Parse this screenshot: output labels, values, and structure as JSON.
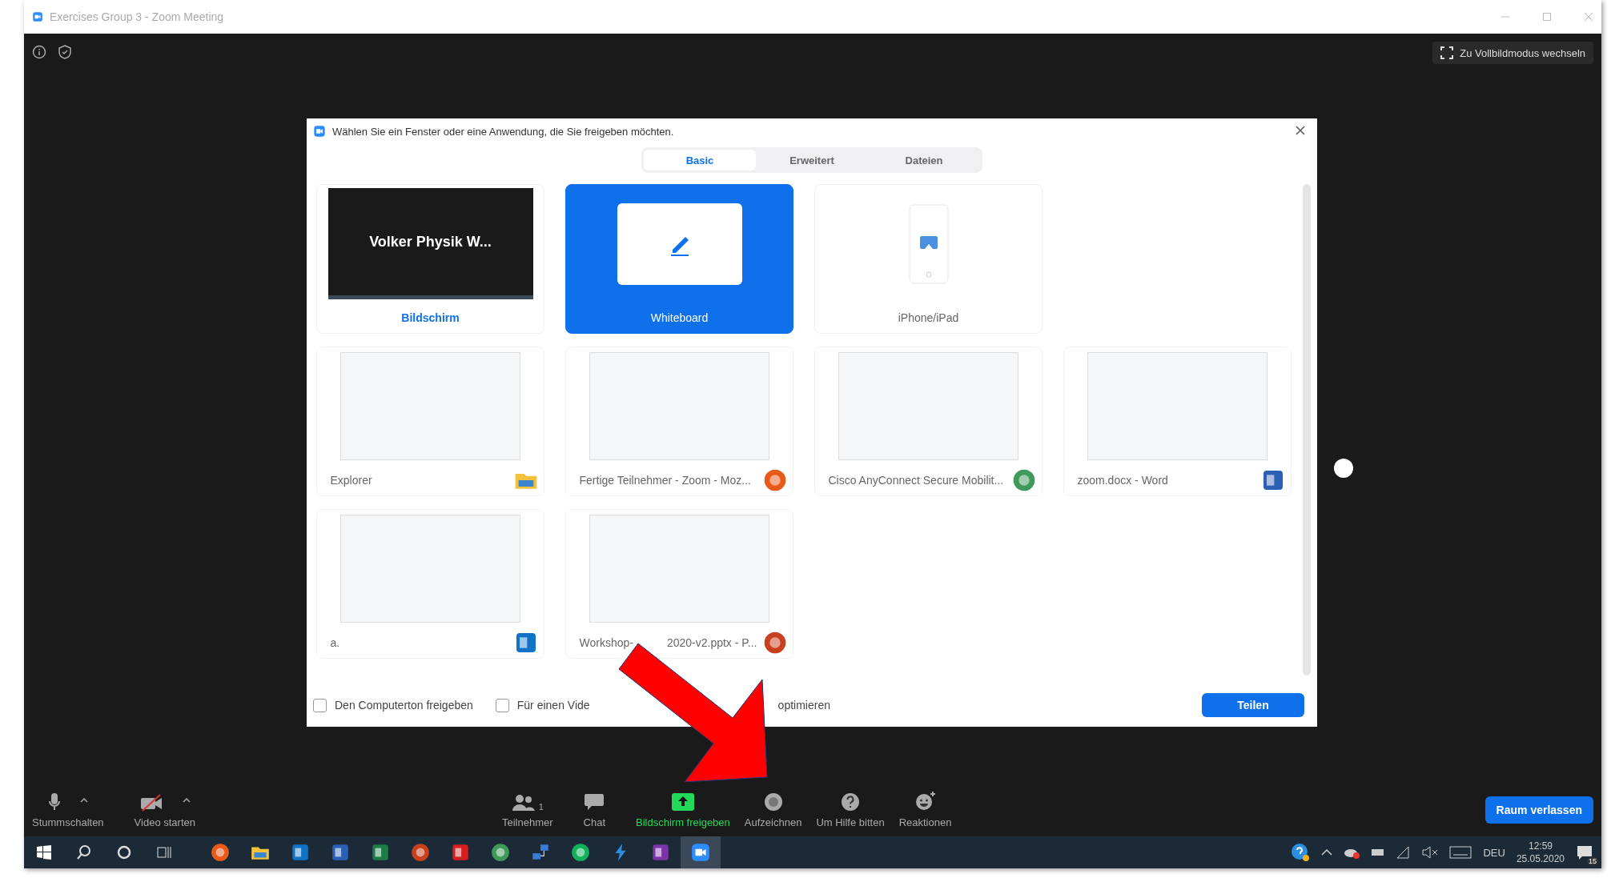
{
  "window": {
    "title": "Exercises Group 3 - Zoom Meeting"
  },
  "fullscreen_button": "Zu Vollbildmodus wechseln",
  "dialog": {
    "title": "Wählen Sie ein Fenster oder eine Anwendung, die Sie freigeben möchten.",
    "tabs": [
      {
        "label": "Basic",
        "selected": true
      },
      {
        "label": "Erweitert",
        "selected": false
      },
      {
        "label": "Dateien",
        "selected": false
      }
    ],
    "sources": [
      {
        "kind": "screen",
        "label": "Bildschirm",
        "selected": false,
        "emphasized": true,
        "preview_text": "Volker Physik W..."
      },
      {
        "kind": "whiteboard",
        "label": "Whiteboard",
        "selected": true,
        "emphasized": false
      },
      {
        "kind": "device",
        "label": "iPhone/iPad",
        "selected": false,
        "emphasized": false
      },
      {
        "kind": "folder",
        "label": "Explorer",
        "selected": false,
        "emphasized": false
      },
      {
        "kind": "browser",
        "label": "Fertige Teilnehmer - Zoom - Moz...",
        "selected": false,
        "emphasized": false
      },
      {
        "kind": "globe",
        "label": "Cisco AnyConnect Secure Mobilit...",
        "selected": false,
        "emphasized": false
      },
      {
        "kind": "document",
        "label": "zoom.docx - Word",
        "selected": false,
        "emphasized": false
      },
      {
        "kind": "mail",
        "label": "a.",
        "selected": false,
        "emphasized": false
      },
      {
        "kind": "presentation",
        "label": "Workshop-",
        "label_end": "2020-v2.pptx - P...",
        "selected": false,
        "emphasized": false
      }
    ],
    "options": [
      {
        "label": "Den Computerton freigeben",
        "checked": false
      },
      {
        "label": "Für einen Vide",
        "label_end": "optimieren",
        "checked": false
      }
    ],
    "share_button": "Teilen"
  },
  "toolbar": [
    {
      "kind": "mic",
      "label": "Stummschalten",
      "caret": true,
      "highlighted": false
    },
    {
      "kind": "video-off",
      "label": "Video starten",
      "caret": true,
      "highlighted": false
    },
    {
      "kind": "participants",
      "label": "Teilnehmer",
      "count": "1",
      "caret": false,
      "highlighted": false
    },
    {
      "kind": "chat",
      "label": "Chat",
      "caret": false,
      "highlighted": false
    },
    {
      "kind": "share",
      "label": "Bildschirm freigeben",
      "caret": false,
      "highlighted": true
    },
    {
      "kind": "record",
      "label": "Aufzeichnen",
      "caret": false,
      "highlighted": false
    },
    {
      "kind": "help",
      "label": "Um Hilfe bitten",
      "caret": false,
      "highlighted": false
    },
    {
      "kind": "reaction",
      "label": "Reaktionen",
      "caret": false,
      "highlighted": false
    }
  ],
  "leave_button": "Raum verlassen",
  "taskbar": {
    "apps": [
      {
        "kind": "start",
        "active": false
      },
      {
        "kind": "search",
        "active": false
      },
      {
        "kind": "cortana",
        "active": false
      },
      {
        "kind": "taskview",
        "active": false
      },
      {
        "kind": "browser",
        "active": false
      },
      {
        "kind": "folder",
        "active": false
      },
      {
        "kind": "mail",
        "active": false
      },
      {
        "kind": "document",
        "active": false
      },
      {
        "kind": "spreadsheet",
        "active": false
      },
      {
        "kind": "presentation",
        "active": false
      },
      {
        "kind": "pdf",
        "active": false
      },
      {
        "kind": "globe",
        "active": false
      },
      {
        "kind": "network",
        "active": false
      },
      {
        "kind": "chat-app",
        "active": false
      },
      {
        "kind": "lightning",
        "active": false
      },
      {
        "kind": "notebook",
        "active": false
      },
      {
        "kind": "video",
        "active": true
      }
    ],
    "language": "DEU",
    "time": "12:59",
    "date": "25.05.2020",
    "notification_count": "15"
  }
}
